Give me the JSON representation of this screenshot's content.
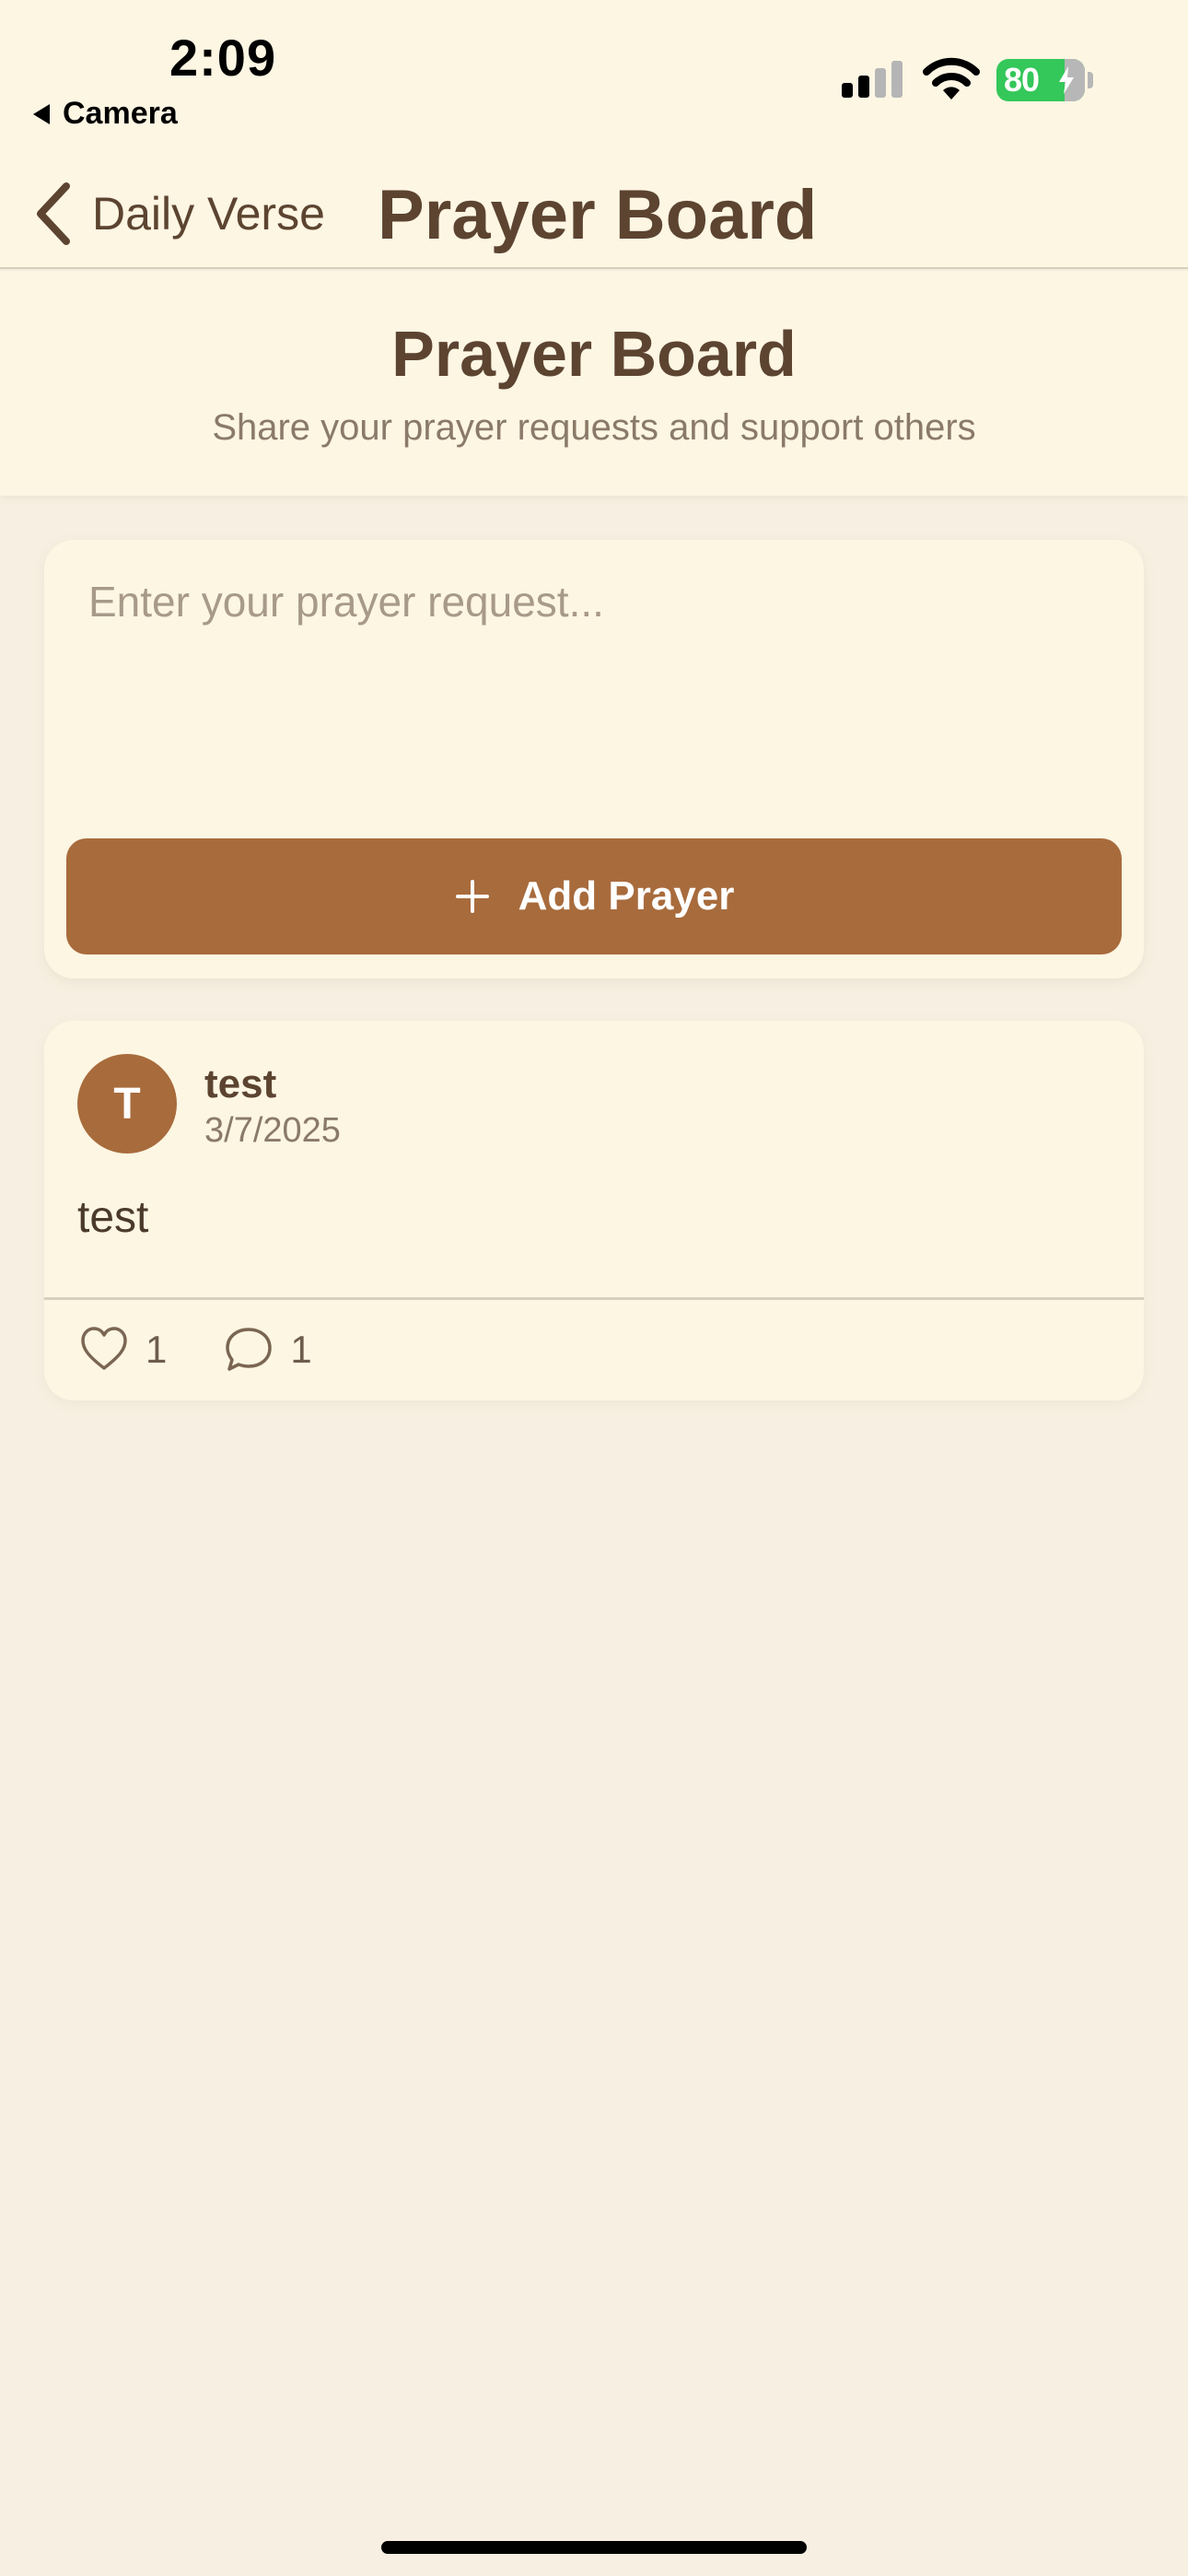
{
  "status_bar": {
    "time": "2:09",
    "back_app": "Camera",
    "battery": "80"
  },
  "nav": {
    "back_label": "Daily Verse",
    "title": "Prayer Board"
  },
  "header": {
    "title": "Prayer Board",
    "subtitle": "Share your prayer requests and support others"
  },
  "composer": {
    "placeholder": "Enter your prayer request...",
    "value": "",
    "button_label": "Add Prayer"
  },
  "prayers": [
    {
      "avatar_initial": "T",
      "author": "test",
      "date": "3/7/2025",
      "text": "test",
      "likes": "1",
      "comments": "1"
    }
  ],
  "colors": {
    "background": "#F7F0E2",
    "card": "#FDF6E3",
    "accent": "#A86B3C",
    "text_primary": "#5C4431",
    "text_secondary": "#8A7A68",
    "battery": "#34C759"
  },
  "icons": {
    "back": "chevron-left-icon",
    "add": "plus-icon",
    "like": "heart-outline-icon",
    "comment": "speech-bubble-icon"
  }
}
